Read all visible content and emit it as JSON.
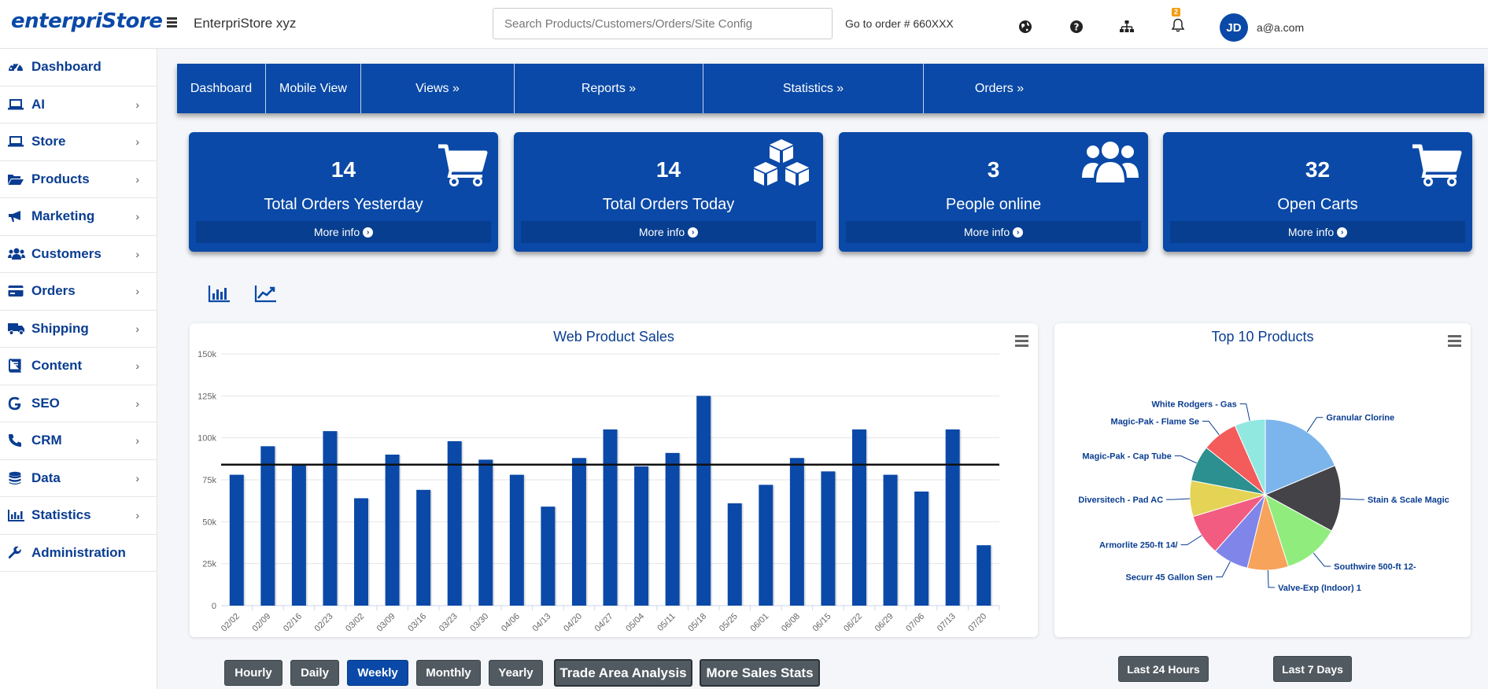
{
  "header": {
    "logo": "enterpriStore",
    "site_name": "EnterpriStore xyz",
    "search_placeholder": "Search Products/Customers/Orders/Site Config",
    "goto_order": "Go to order # 660XXX",
    "notifications_count": "2",
    "user_initials": "JD",
    "user_email": "a@a.com"
  },
  "sidebar": {
    "items": [
      {
        "label": "Dashboard",
        "icon": "gauge-icon",
        "has_chevron": false
      },
      {
        "label": "AI",
        "icon": "laptop-icon",
        "has_chevron": true
      },
      {
        "label": "Store",
        "icon": "laptop-icon",
        "has_chevron": true
      },
      {
        "label": "Products",
        "icon": "folder-open-icon",
        "has_chevron": true
      },
      {
        "label": "Marketing",
        "icon": "bullhorn-icon",
        "has_chevron": true
      },
      {
        "label": "Customers",
        "icon": "users-icon",
        "has_chevron": true
      },
      {
        "label": "Orders",
        "icon": "credit-card-icon",
        "has_chevron": true
      },
      {
        "label": "Shipping",
        "icon": "truck-icon",
        "has_chevron": true
      },
      {
        "label": "Content",
        "icon": "book-icon",
        "has_chevron": true
      },
      {
        "label": "SEO",
        "icon": "google-icon",
        "has_chevron": true
      },
      {
        "label": "CRM",
        "icon": "phone-icon",
        "has_chevron": true
      },
      {
        "label": "Data",
        "icon": "database-icon",
        "has_chevron": true
      },
      {
        "label": "Statistics",
        "icon": "bar-chart-icon",
        "has_chevron": true
      },
      {
        "label": "Administration",
        "icon": "wrench-icon",
        "has_chevron": false
      }
    ]
  },
  "navbar": {
    "items": [
      {
        "label": "Dashboard"
      },
      {
        "label": "Mobile View"
      },
      {
        "label": "Views »"
      },
      {
        "label": "Reports »"
      },
      {
        "label": "Statistics »"
      },
      {
        "label": "Orders »"
      }
    ]
  },
  "infoboxes": [
    {
      "value": "14",
      "label": "Total Orders Yesterday",
      "more": "More info",
      "icon": "cart-icon"
    },
    {
      "value": "14",
      "label": "Total Orders Today",
      "more": "More info",
      "icon": "cubes-icon"
    },
    {
      "value": "3",
      "label": "People online",
      "more": "More info",
      "icon": "users-icon"
    },
    {
      "value": "32",
      "label": "Open Carts",
      "more": "More info",
      "icon": "cart-icon"
    }
  ],
  "colors": {
    "primary": "#0a49a7",
    "button_gray": "#515a61",
    "title_blue": "#0a3d91"
  },
  "chart_data": [
    {
      "type": "bar",
      "title": "Web Product Sales",
      "categories": [
        "02/02",
        "02/09",
        "02/16",
        "02/23",
        "03/02",
        "03/09",
        "03/16",
        "03/23",
        "03/30",
        "04/06",
        "04/13",
        "04/20",
        "04/27",
        "05/04",
        "05/11",
        "05/18",
        "05/25",
        "06/01",
        "06/08",
        "06/15",
        "06/22",
        "06/29",
        "07/06",
        "07/13",
        "07/20"
      ],
      "values": [
        78000,
        95000,
        84000,
        104000,
        64000,
        90000,
        69000,
        98000,
        87000,
        78000,
        59000,
        88000,
        105000,
        83000,
        91000,
        125000,
        61000,
        72000,
        88000,
        80000,
        105000,
        78000,
        68000,
        105000,
        36000
      ],
      "average_line": 84000,
      "ylim": [
        0,
        150000
      ],
      "yticks": [
        "0",
        "25k",
        "50k",
        "75k",
        "100k",
        "125k",
        "150k"
      ],
      "ytick_values": [
        0,
        25000,
        50000,
        75000,
        100000,
        125000,
        150000
      ],
      "grid": true,
      "color": "#0a49a7"
    },
    {
      "type": "pie",
      "title": "Top 10 Products",
      "slices": [
        {
          "label": "Granular Clorine",
          "value": 17,
          "color": "#7cb5ec"
        },
        {
          "label": "Stain & Scale Magic",
          "value": 13,
          "color": "#434348"
        },
        {
          "label": "Southwire 500-ft 12-",
          "value": 11,
          "color": "#90ed7d"
        },
        {
          "label": "Valve-Exp (Indoor) 1",
          "value": 8,
          "color": "#f7a35c"
        },
        {
          "label": "Securr 45 Gallon Sen",
          "value": 7,
          "color": "#8085e9"
        },
        {
          "label": "Armorlite 250-ft 14/",
          "value": 8,
          "color": "#f15c80"
        },
        {
          "label": "Diversitech - Pad AC",
          "value": 7,
          "color": "#e4d354"
        },
        {
          "label": "Magic-Pak - Cap Tube",
          "value": 7,
          "color": "#2b908f"
        },
        {
          "label": "Magic-Pak - Flame Se",
          "value": 7,
          "color": "#f45b5b"
        },
        {
          "label": "White Rodgers - Gas",
          "value": 6,
          "color": "#91e8e1"
        }
      ]
    }
  ],
  "bottom_buttons": {
    "period": [
      {
        "label": "Hourly",
        "active": false
      },
      {
        "label": "Daily",
        "active": false
      },
      {
        "label": "Weekly",
        "active": true
      },
      {
        "label": "Monthly",
        "active": false
      },
      {
        "label": "Yearly",
        "active": false
      }
    ],
    "trade_area": "Trade Area Analysis",
    "more_stats": "More Sales Stats",
    "last_24": "Last 24 Hours",
    "last_7": "Last 7 Days"
  }
}
